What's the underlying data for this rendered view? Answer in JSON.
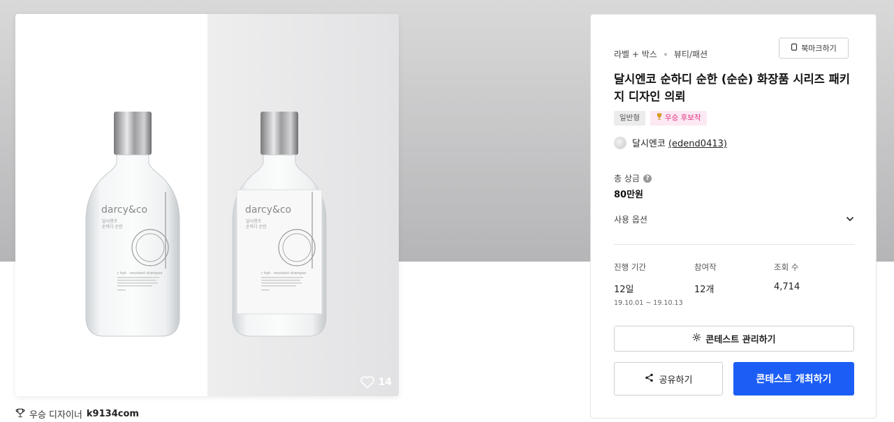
{
  "gallery": {
    "likes_count": "14",
    "bottle_brand": "darcy&co",
    "bottle_line1": "달시엔코",
    "bottle_line2": "순하디 순한",
    "bottle_product": "r hair · resistant shampoo",
    "bottle_letter": "d"
  },
  "winner": {
    "label": "우승 디자이너",
    "name": "k9134com"
  },
  "contest": {
    "category_main": "라벨 + 박스",
    "category_sub": "뷰티/패션",
    "bookmark_label": "북마크하기",
    "title": "달시엔코 순하디 순한 (순순) 화장품 시리즈 패키지 디자인 의뢰",
    "tag_type": "일반형",
    "tag_award": "우승 후보작",
    "host_name": "달시엔코",
    "host_id": "(edend0413)",
    "prize_label": "총 상금",
    "prize_value": "80만원",
    "usage_label": "사용 옵션",
    "period_label": "진행 기간",
    "period_value": "12일",
    "period_range": "19.10.01 ~ 19.10.13",
    "participants_label": "참여작",
    "participants_value": "12개",
    "views_label": "조회 수",
    "views_value": "4,714",
    "manage_label": "콘테스트 관리하기",
    "share_label": "공유하기",
    "host_button_label": "콘테스트 개최하기"
  },
  "colors": {
    "primary": "#1c5ef5",
    "award_pink": "#e0307e",
    "award_bg": "#fde9f3"
  }
}
